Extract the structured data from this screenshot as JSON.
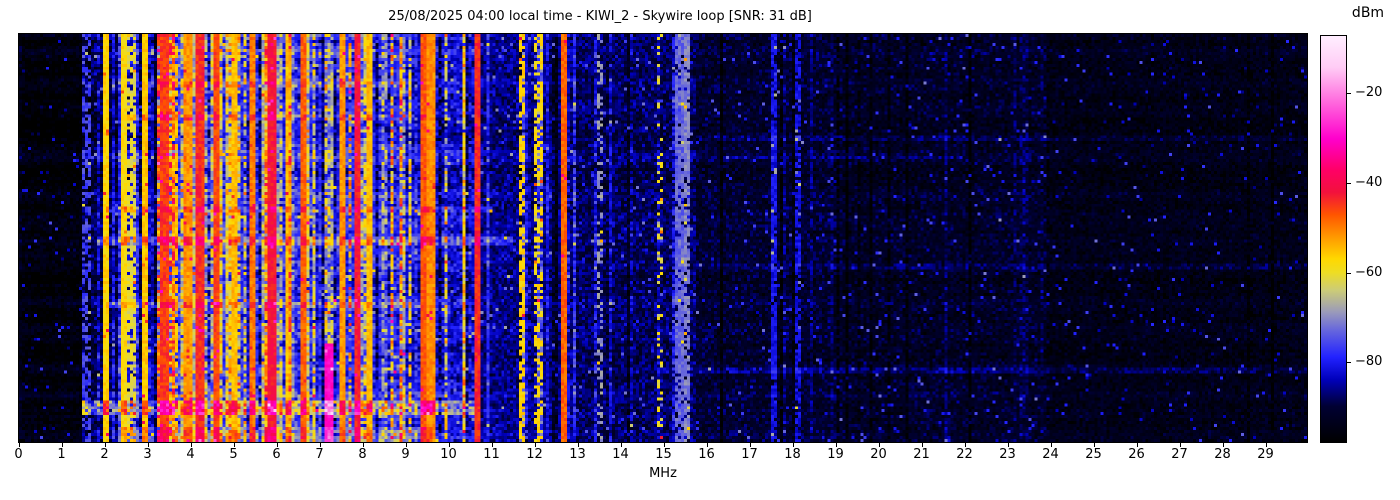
{
  "chart_data": {
    "type": "heatmap",
    "title": "25/08/2025 04:00 local time - KIWI_2 - Skywire loop [SNR: 31 dB]",
    "xlabel": "MHz",
    "x_range": [
      0,
      30
    ],
    "x_ticks": [
      0,
      1,
      2,
      3,
      4,
      5,
      6,
      7,
      8,
      9,
      10,
      11,
      12,
      13,
      14,
      15,
      16,
      17,
      18,
      19,
      20,
      21,
      22,
      23,
      24,
      25,
      26,
      27,
      28,
      29
    ],
    "colorbar": {
      "label": "dBm",
      "ticks": [
        -20,
        -40,
        -60,
        -80
      ],
      "range_top": -7,
      "range_bottom": -98,
      "stops": [
        [
          -7,
          "#ffeeff"
        ],
        [
          -14,
          "#ffccf5"
        ],
        [
          -22,
          "#ff66dd"
        ],
        [
          -30,
          "#ff00cc"
        ],
        [
          -37,
          "#ff0066"
        ],
        [
          -42,
          "#f2113c"
        ],
        [
          -47,
          "#ff5500"
        ],
        [
          -52,
          "#ff9900"
        ],
        [
          -57,
          "#ffd800"
        ],
        [
          -60,
          "#eedd22"
        ],
        [
          -64,
          "#cccc77"
        ],
        [
          -69,
          "#9999bb"
        ],
        [
          -73,
          "#6666dd"
        ],
        [
          -79,
          "#2222ff"
        ],
        [
          -84,
          "#0000bb"
        ],
        [
          -90,
          "#000033"
        ],
        [
          -98,
          "#000000"
        ]
      ]
    },
    "spectrogram": {
      "seed": 7,
      "grid_cols": 430,
      "grid_rows": 137,
      "fleck_prob": 0.025,
      "fleck_boost": 12,
      "hot_pixel_prob": 0.002,
      "bands": [
        {
          "f0": 0.0,
          "f1": 1.45,
          "base": -96,
          "noise": 5,
          "stripe_prob": 0.03,
          "s_min": 2,
          "s_max": 7
        },
        {
          "f0": 1.45,
          "f1": 2.3,
          "base": -89,
          "noise": 7,
          "stripe_prob": 0.15,
          "s_min": 3,
          "s_max": 12
        },
        {
          "f0": 2.3,
          "f1": 3.2,
          "base": -83,
          "noise": 8,
          "stripe_prob": 0.35,
          "s_min": 5,
          "s_max": 20
        },
        {
          "f0": 3.2,
          "f1": 5.1,
          "base": -76,
          "noise": 9,
          "stripe_prob": 0.62,
          "s_min": 7,
          "s_max": 30
        },
        {
          "f0": 5.1,
          "f1": 9.0,
          "base": -78,
          "noise": 9,
          "stripe_prob": 0.55,
          "s_min": 7,
          "s_max": 30
        },
        {
          "f0": 9.0,
          "f1": 10.7,
          "base": -82,
          "noise": 8,
          "stripe_prob": 0.38,
          "s_min": 5,
          "s_max": 26
        },
        {
          "f0": 10.7,
          "f1": 13.0,
          "base": -86,
          "noise": 7,
          "stripe_prob": 0.22,
          "s_min": 4,
          "s_max": 16
        },
        {
          "f0": 13.0,
          "f1": 15.8,
          "base": -88,
          "noise": 7,
          "stripe_prob": 0.16,
          "s_min": 3,
          "s_max": 11
        },
        {
          "f0": 15.8,
          "f1": 19.2,
          "base": -91,
          "noise": 6,
          "stripe_prob": 0.1,
          "s_min": 2,
          "s_max": 6
        },
        {
          "f0": 19.2,
          "f1": 24.0,
          "base": -92,
          "noise": 6,
          "stripe_prob": 0.05,
          "s_min": 2,
          "s_max": 5
        },
        {
          "f0": 24.0,
          "f1": 30.0,
          "base": -94,
          "noise": 5,
          "stripe_prob": 0.03,
          "s_min": 1,
          "s_max": 4
        }
      ],
      "carriers": [
        {
          "f": 1.53,
          "w": 0.04,
          "lvl": -76,
          "dash": 0.55
        },
        {
          "f": 2.0,
          "w": 0.05,
          "lvl": -57
        },
        {
          "f": 2.43,
          "w": 0.05,
          "lvl": -58
        },
        {
          "f": 2.58,
          "w": 0.04,
          "lvl": -61,
          "dash": 0.7
        },
        {
          "f": 2.9,
          "w": 0.05,
          "lvl": -56
        },
        {
          "f": 3.33,
          "w": 0.06,
          "lvl": -45
        },
        {
          "f": 3.62,
          "w": 0.04,
          "lvl": -55,
          "dash": 0.8
        },
        {
          "f": 3.9,
          "w": 0.05,
          "lvl": -52
        },
        {
          "f": 4.2,
          "w": 0.07,
          "lvl": -44
        },
        {
          "f": 4.55,
          "w": 0.05,
          "lvl": -46
        },
        {
          "f": 5.0,
          "w": 0.04,
          "lvl": -55
        },
        {
          "f": 5.4,
          "w": 0.04,
          "lvl": -50
        },
        {
          "f": 5.86,
          "w": 0.06,
          "lvl": -42
        },
        {
          "f": 6.25,
          "w": 0.04,
          "lvl": -55
        },
        {
          "f": 6.6,
          "w": 0.05,
          "lvl": -48
        },
        {
          "f": 7.2,
          "w": 0.05,
          "lvl": -30,
          "t0": 0.76,
          "t1": 1.0
        },
        {
          "f": 7.5,
          "w": 0.04,
          "lvl": -52
        },
        {
          "f": 7.84,
          "w": 0.06,
          "lvl": -43
        },
        {
          "f": 8.1,
          "w": 0.04,
          "lvl": -55
        },
        {
          "f": 9.4,
          "w": 0.07,
          "lvl": -47
        },
        {
          "f": 9.55,
          "w": 0.05,
          "lvl": -51
        },
        {
          "f": 10.65,
          "w": 0.05,
          "lvl": -44
        },
        {
          "f": 11.7,
          "w": 0.04,
          "lvl": -57,
          "dash": 0.65
        },
        {
          "f": 12.07,
          "w": 0.04,
          "lvl": -58,
          "dash": 0.55
        },
        {
          "f": 12.67,
          "w": 0.06,
          "lvl": -48
        },
        {
          "f": 13.5,
          "w": 0.03,
          "lvl": -69,
          "dash": 0.4
        },
        {
          "f": 14.87,
          "w": 0.04,
          "lvl": -60,
          "dash": 0.25
        },
        {
          "f": 15.35,
          "w": 0.05,
          "lvl": -73,
          "dash": 0.85
        },
        {
          "f": 15.55,
          "w": 0.04,
          "lvl": -71,
          "dash": 0.8
        },
        {
          "f": 17.55,
          "w": 0.04,
          "lvl": -81,
          "dash": 0.85
        },
        {
          "f": 18.1,
          "w": 0.04,
          "lvl": -81,
          "dash": 0.7
        }
      ],
      "events": [
        {
          "t0": 0.9,
          "t1": 0.935,
          "f0": 1.5,
          "f1": 10.6,
          "boost": 13
        },
        {
          "t0": 0.96,
          "t1": 1.0,
          "f0": 2.3,
          "f1": 9.6,
          "boost": 6
        },
        {
          "t0": 0.5,
          "t1": 0.52,
          "f0": 1.8,
          "f1": 11.5,
          "boost": 8
        },
        {
          "t0": 0.42,
          "t1": 0.437,
          "f0": 2.0,
          "f1": 11.0,
          "boost": 7
        },
        {
          "t0": 0.2,
          "t1": 0.215,
          "f0": 2.5,
          "f1": 9.5,
          "boost": 6
        },
        {
          "t0": 0.655,
          "t1": 0.668,
          "f0": 2.0,
          "f1": 9.2,
          "boost": 5
        },
        {
          "t0": 0.12,
          "t1": 0.132,
          "f0": 3.0,
          "f1": 9.0,
          "boost": 5
        },
        {
          "t0": 0.25,
          "t1": 0.262,
          "f0": 15.8,
          "f1": 30,
          "boost": 4
        },
        {
          "t0": 0.565,
          "t1": 0.576,
          "f0": 15.8,
          "f1": 30,
          "boost": 3
        },
        {
          "t0": 0.82,
          "t1": 0.832,
          "f0": 15.8,
          "f1": 30,
          "boost": 4
        },
        {
          "t0": 0.3,
          "t1": 0.31,
          "f0": 16.5,
          "f1": 22,
          "boost": 3
        }
      ]
    }
  }
}
